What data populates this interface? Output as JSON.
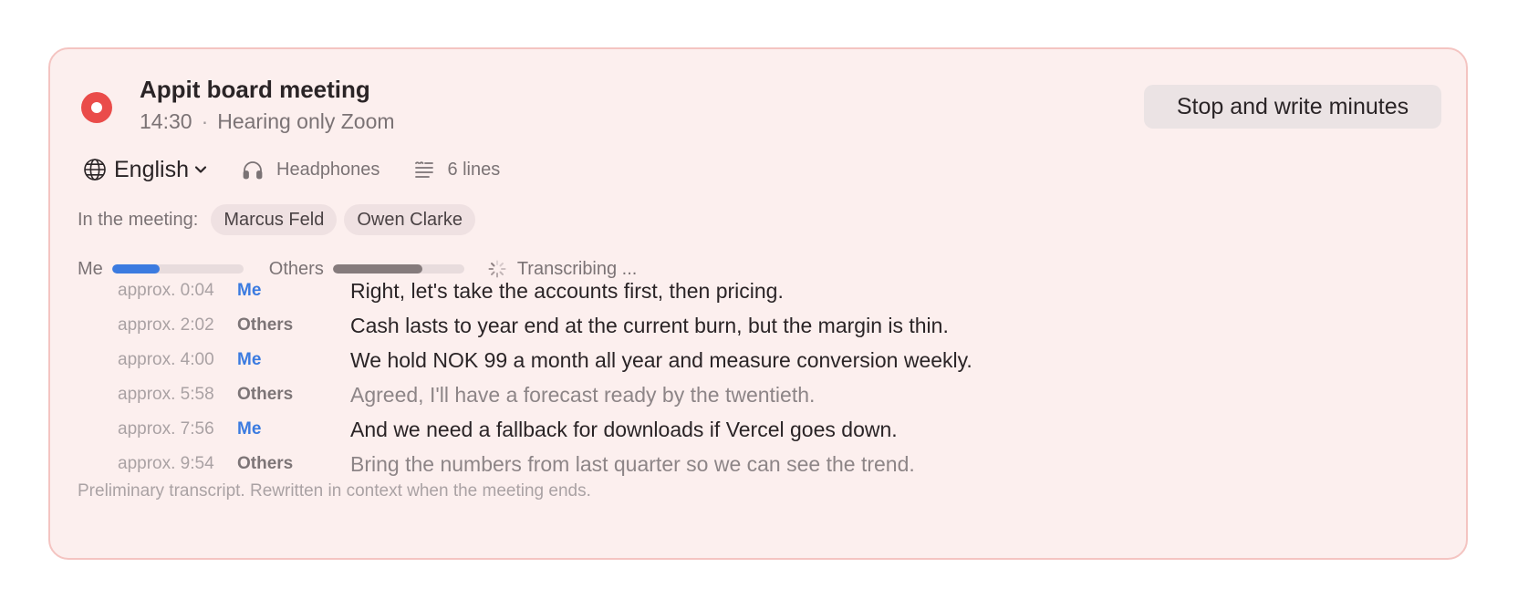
{
  "meeting": {
    "title": "Appit board meeting",
    "time": "14:30",
    "separator": "·",
    "source": "Hearing only Zoom",
    "stop_label": "Stop and write minutes"
  },
  "toolbar": {
    "language": "English",
    "audio": "Headphones",
    "lines": "6 lines"
  },
  "participants": {
    "label": "In the meeting:",
    "names": [
      "Marcus Feld",
      "Owen Clarke"
    ]
  },
  "levels": {
    "me_label": "Me",
    "me_level": 0.36,
    "others_label": "Others",
    "others_level": 0.68,
    "status": "Transcribing ..."
  },
  "transcript": [
    {
      "time": "approx. 0:04",
      "speaker": "Me",
      "text": "Right, let's take the accounts first, then pricing."
    },
    {
      "time": "approx. 2:02",
      "speaker": "Others",
      "text": "Cash lasts to year end at the current burn, but the margin is thin."
    },
    {
      "time": "approx. 4:00",
      "speaker": "Me",
      "text": "We hold NOK 99 a month all year and measure conversion weekly."
    },
    {
      "time": "approx. 5:58",
      "speaker": "Others",
      "text": "Agreed, I'll have a forecast ready by the twentieth."
    },
    {
      "time": "approx. 7:56",
      "speaker": "Me",
      "text": "And we need a fallback for downloads if Vercel goes down."
    },
    {
      "time": "approx. 9:54",
      "speaker": "Others",
      "text": "Bring the numbers from last quarter so we can see the trend."
    }
  ],
  "footer": "Preliminary transcript. Rewritten in context when the meeting ends.",
  "colors": {
    "card_background": "#fcefee",
    "card_border": "#f4c4c1",
    "recording": "#ea4c4a",
    "me_accent": "#3b7be0",
    "others_meter": "#857b7c",
    "muted_text": "#7b7375"
  },
  "icons": {
    "recording": "record-icon",
    "language": "globe-icon",
    "language_menu": "chevron-down-icon",
    "audio": "headphones-icon",
    "lines": "lines-icon",
    "status": "spinner-icon"
  }
}
